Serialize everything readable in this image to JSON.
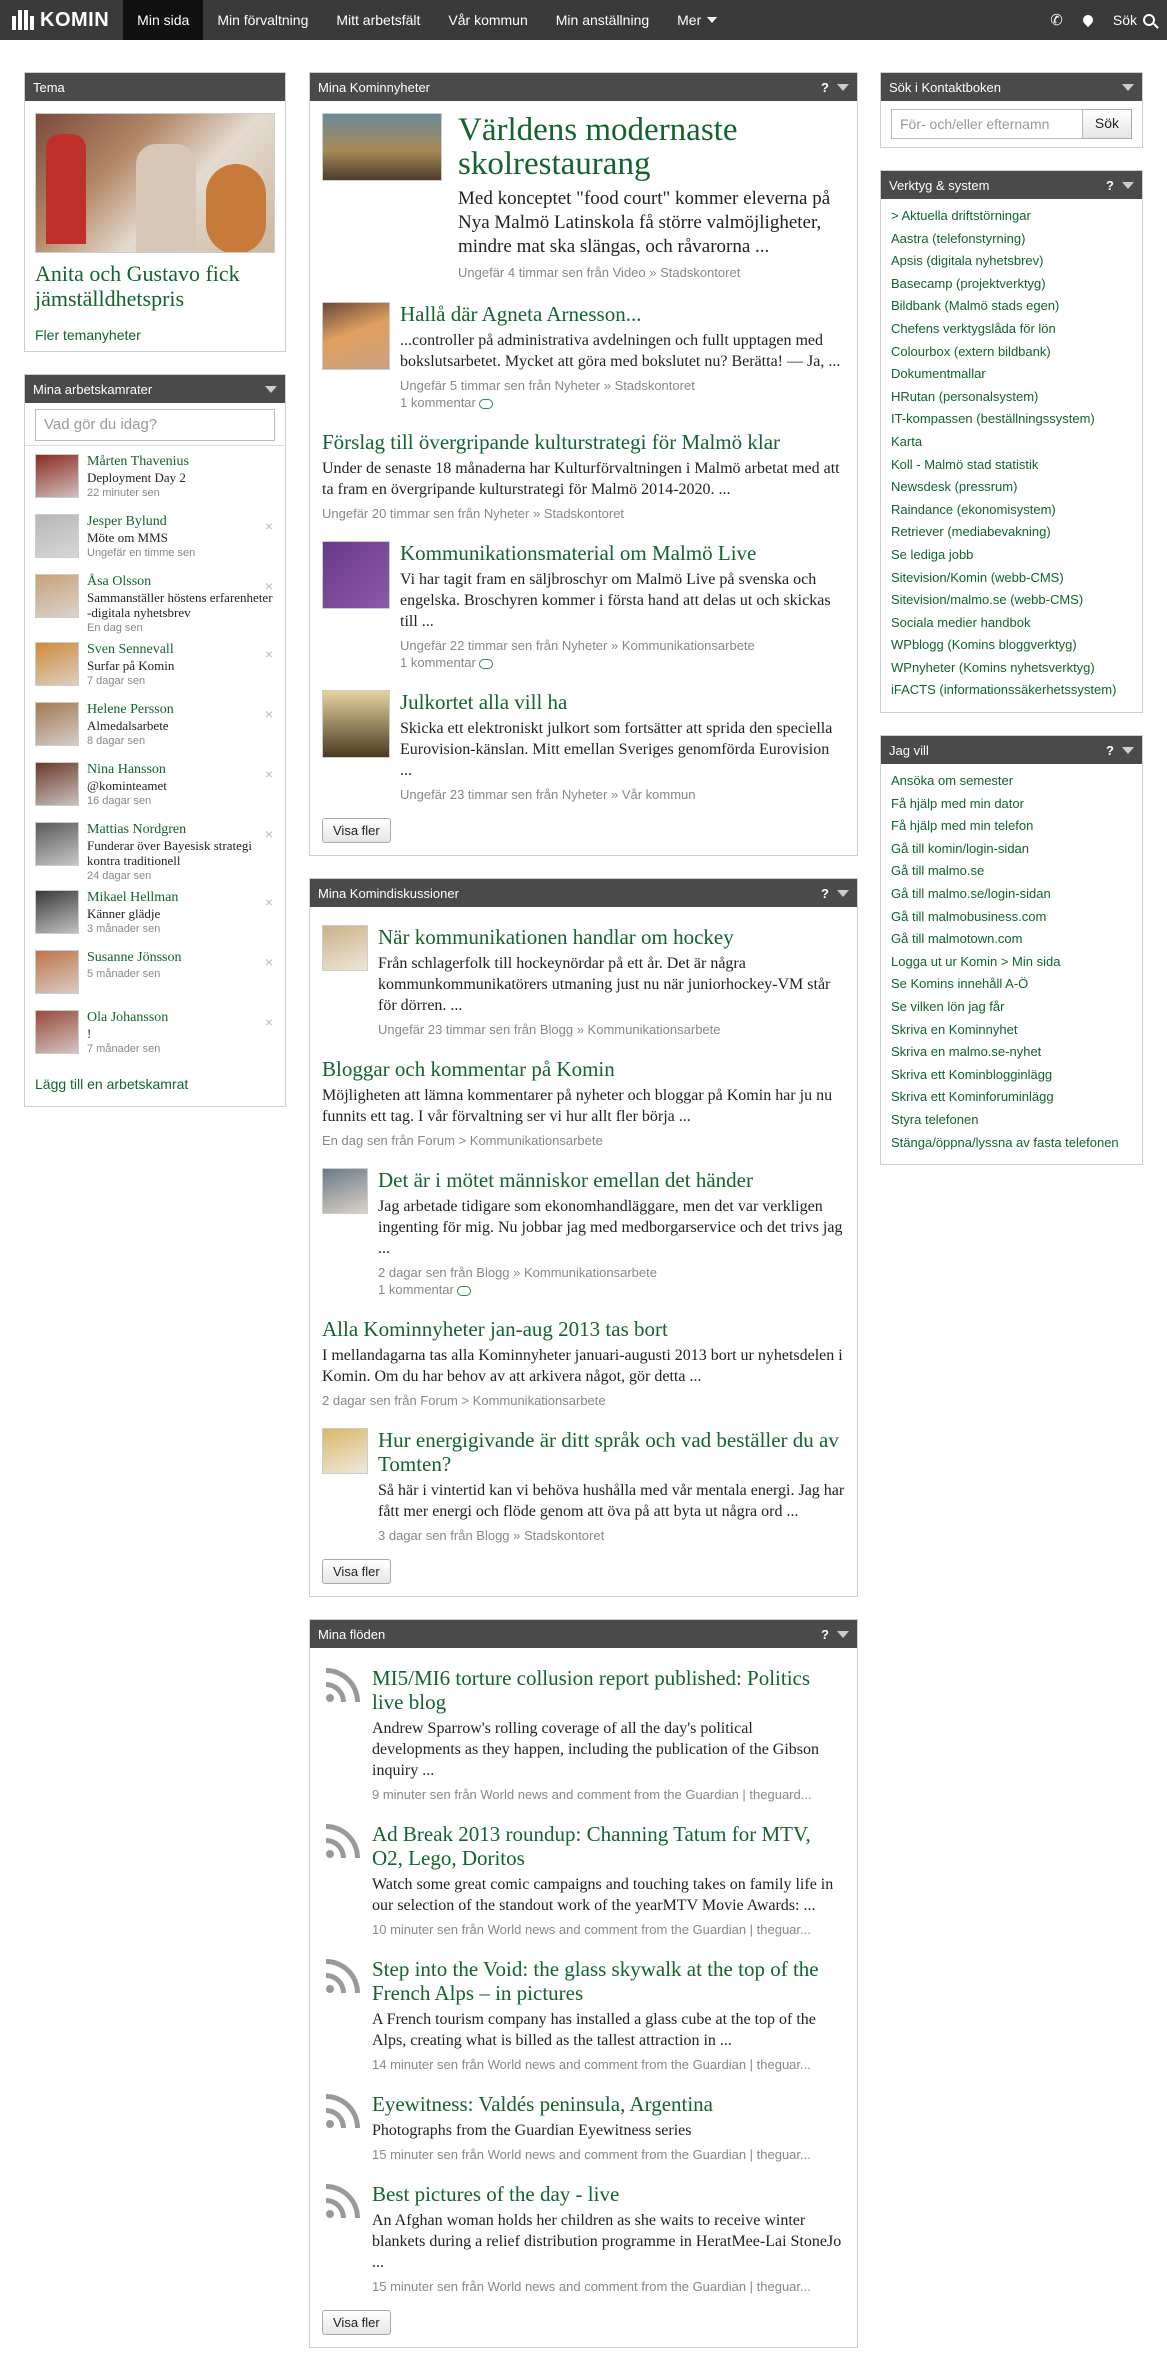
{
  "nav": {
    "logo": "KOMIN",
    "items": [
      "Min sida",
      "Min förvaltning",
      "Mitt arbetsfält",
      "Vår kommun",
      "Min anställning",
      "Mer"
    ],
    "search_label": "Sök"
  },
  "tema": {
    "header": "Tema",
    "title": "Anita och Gustavo fick jämställdhetspris",
    "more": "Fler temanyheter"
  },
  "colleagues": {
    "header": "Mina arbetskamrater",
    "placeholder": "Vad gör du idag?",
    "items": [
      {
        "name": "Mårten Thavenius",
        "status": "Deployment Day 2",
        "time": "22 minuter sen"
      },
      {
        "name": "Jesper Bylund",
        "status": "Möte om MMS",
        "time": "Ungefär en timme sen"
      },
      {
        "name": "Åsa Olsson",
        "status": "Sammanställer höstens erfarenheter -digitala nyhetsbrev",
        "time": "En dag sen"
      },
      {
        "name": "Sven Sennevall",
        "status": "Surfar på Komin",
        "time": "7 dagar sen"
      },
      {
        "name": "Helene Persson",
        "status": "Almedalsarbete",
        "time": "8 dagar sen"
      },
      {
        "name": "Nina Hansson",
        "status": "@kominteamet",
        "time": "16 dagar sen"
      },
      {
        "name": "Mattias Nordgren",
        "status": "Funderar över Bayesisk strategi kontra traditionell",
        "time": "24 dagar sen"
      },
      {
        "name": "Mikael Hellman",
        "status": "Känner glädje",
        "time": "3 månader sen"
      },
      {
        "name": "Susanne Jönsson",
        "status": "",
        "time": "5 månader sen"
      },
      {
        "name": "Ola Johansson",
        "status": "!",
        "time": "7 månader sen"
      }
    ],
    "add": "Lägg till en arbetskamrat"
  },
  "news": {
    "header": "Mina Kominnyheter",
    "feature": {
      "title": "Världens modernaste skolrestaurang",
      "text": "Med konceptet \"food court\" kommer eleverna på Nya Malmö Latinskola få större valmöjligheter, mindre mat ska slängas, och råvarorna ...",
      "meta": "Ungefär 4 timmar sen från Video » Stadskontoret"
    },
    "items": [
      {
        "title": "Hallå där Agneta Arnesson...",
        "text": "...controller på administrativa avdelningen och fullt upptagen med bokslutsarbetet. Mycket att göra med bokslutet nu? Berätta! — Ja, ...",
        "meta": "Ungefär 5 timmar sen från Nyheter » Stadskontoret",
        "comments": "1 kommentar"
      },
      {
        "title": "Förslag till övergripande kulturstrategi för Malmö klar",
        "text": "Under de senaste 18 månaderna har Kulturförvaltningen i Malmö arbetat med att ta fram en övergripande kulturstrategi för Malmö 2014-2020. ...",
        "meta": "Ungefär 20 timmar sen från Nyheter » Stadskontoret",
        "comments": ""
      },
      {
        "title": "Kommunikationsmaterial om Malmö Live",
        "text": "Vi har tagit fram en säljbroschyr om Malmö Live på svenska och engelska. Broschyren kommer i första hand att delas ut och skickas till ...",
        "meta": "Ungefär 22 timmar sen från Nyheter » Kommunikationsarbete",
        "comments": "1 kommentar"
      },
      {
        "title": "Julkortet alla vill ha",
        "text": "Skicka ett elektroniskt julkort som fortsätter att sprida den speciella Eurovision-känslan. Mitt emellan Sveriges genomförda Eurovision ...",
        "meta": "Ungefär 23 timmar sen från Nyheter » Vår kommun",
        "comments": ""
      }
    ],
    "more": "Visa fler"
  },
  "discussions": {
    "header": "Mina Komindiskussioner",
    "items": [
      {
        "title": "När kommunikationen handlar om hockey",
        "text": "Från schlagerfolk till hockeynördar på ett år. Det är några kommunkommunikatörers utmaning just nu när juniorhockey-VM står för dörren. ...",
        "meta": "Ungefär 23 timmar sen från Blogg » Kommunikationsarbete",
        "comments": ""
      },
      {
        "title": "Bloggar och kommentar på Komin",
        "text": "Möjligheten att lämna kommentarer på nyheter och bloggar på Komin har ju nu funnits ett tag. I vår förvaltning ser vi hur allt fler börja ...",
        "meta": "En dag sen från Forum > Kommunikationsarbete",
        "comments": ""
      },
      {
        "title": "Det är i mötet människor emellan det händer",
        "text": "Jag arbetade tidigare som ekonomhandläggare, men det var verkligen ingenting för mig. Nu jobbar jag med medborgarservice och det trivs jag ...",
        "meta": "2 dagar sen från Blogg » Kommunikationsarbete",
        "comments": "1 kommentar"
      },
      {
        "title": "Alla Kominnyheter jan-aug 2013 tas bort",
        "text": "I mellandagarna tas alla Kominnyheter januari-augusti 2013 bort ur nyhetsdelen i Komin. Om du har behov av att arkivera något, gör detta ...",
        "meta": "2 dagar sen från Forum > Kommunikationsarbete",
        "comments": ""
      },
      {
        "title": "Hur energigivande är ditt språk och vad beställer du av Tomten?",
        "text": "Så här i vintertid kan vi behöva hushålla med vår mentala energi. Jag har fått mer energi och flöde genom att öva på att byta ut några ord ...",
        "meta": "3 dagar sen från Blogg » Stadskontoret",
        "comments": ""
      }
    ],
    "more": "Visa fler"
  },
  "feeds": {
    "header": "Mina flöden",
    "items": [
      {
        "title": "MI5/MI6 torture collusion report published: Politics live blog",
        "text": "Andrew Sparrow's rolling coverage of all the day's political developments as they happen, including the publication of the Gibson inquiry ...",
        "meta": "9 minuter sen från World news and comment from the Guardian | theguard..."
      },
      {
        "title": "Ad Break 2013 roundup: Channing Tatum for MTV, O2, Lego, Doritos",
        "text": "Watch some great comic campaigns and touching takes on family life in our selection of the standout work of the yearMTV Movie Awards: ...",
        "meta": "10 minuter sen från World news and comment from the Guardian | theguar..."
      },
      {
        "title": "Step into the Void: the glass skywalk at the top of the French Alps – in pictures",
        "text": "A French tourism company has installed a glass cube at the top of the Alps, creating what is billed as the tallest attraction in ...",
        "meta": "14 minuter sen från World news and comment from the Guardian | theguar..."
      },
      {
        "title": "Eyewitness: Valdés peninsula, Argentina",
        "text": "Photographs from the Guardian Eyewitness series",
        "meta": "15 minuter sen från World news and comment from the Guardian | theguar..."
      },
      {
        "title": "Best pictures of the day - live",
        "text": "An Afghan woman holds her children as she waits to receive winter blankets during a relief distribution programme in HeratMee-Lai StoneJo ...",
        "meta": "15 minuter sen från World news and comment from the Guardian | theguar..."
      }
    ],
    "more": "Visa fler"
  },
  "contacts": {
    "header": "Sök i Kontaktboken",
    "placeholder": "För- och/eller efternamn",
    "button": "Sök"
  },
  "tools": {
    "header": "Verktyg & system",
    "links": [
      "> Aktuella driftstörningar",
      "Aastra (telefonstyrning)",
      "Apsis (digitala nyhetsbrev)",
      "Basecamp (projektverktyg)",
      "Bildbank (Malmö stads egen)",
      "Chefens verktygslåda för lön",
      "Colourbox (extern bildbank)",
      "Dokumentmallar",
      "HRutan (personalsystem)",
      "IT-kompassen (beställningssystem)",
      "Karta",
      "Koll - Malmö stad statistik",
      "Newsdesk (pressrum)",
      "Raindance (ekonomisystem)",
      "Retriever (mediabevakning)",
      "Se lediga jobb",
      "Sitevision/Komin (webb-CMS)",
      "Sitevision/malmo.se (webb-CMS)",
      "Sociala medier handbok",
      "WPblogg (Komins bloggverktyg)",
      "WPnyheter (Komins nyhetsverktyg)",
      "iFACTS (informationssäkerhetssystem)"
    ]
  },
  "want": {
    "header": "Jag vill",
    "links": [
      "Ansöka om semester",
      "Få hjälp med min dator",
      "Få hjälp med min telefon",
      "Gå till komin/login-sidan",
      "Gå till malmo.se",
      "Gå till malmo.se/login-sidan",
      "Gå till malmobusiness.com",
      "Gå till malmotown.com",
      "Logga ut ur Komin > Min sida",
      "Se Komins innehåll A-Ö",
      "Se vilken lön jag får",
      "Skriva en Kominnyhet",
      "Skriva en malmo.se-nyhet",
      "Skriva ett Kominblogginlägg",
      "Skriva ett Kominforuminlägg",
      "Styra telefonen",
      "Stänga/öppna/lyssna av fasta telefonen"
    ]
  },
  "colors": {
    "brand_green": "#14622d",
    "header_bg": "#3a3a3a",
    "panel_head": "#4a4a4a"
  }
}
